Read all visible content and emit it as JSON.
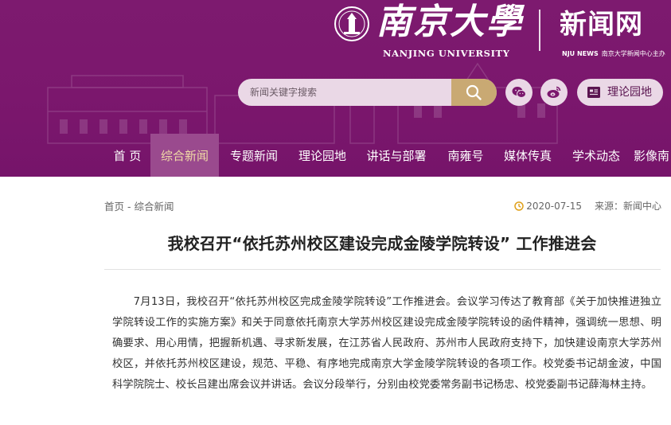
{
  "header": {
    "logo_cn": "南京大學",
    "logo_en": "NANJING UNIVERSITY",
    "site_name": "新闻网",
    "site_sub_brand": "NJU NEWS",
    "site_sub_text": "南京大学新闻中心主办",
    "search_placeholder": "新闻关键字搜索",
    "theory_label": "理论园地",
    "colors": {
      "header_bg": "#7b176d",
      "search_button": "#c9a973",
      "active_nav_bg": "#9a4a8e",
      "active_nav_text": "#f1dca6"
    }
  },
  "nav": {
    "items": [
      {
        "label": "首 页"
      },
      {
        "label": "综合新闻"
      },
      {
        "label": "专题新闻"
      },
      {
        "label": "理论园地"
      },
      {
        "label": "讲话与部署"
      },
      {
        "label": "南雍号"
      },
      {
        "label": "媒体传真"
      },
      {
        "label": "学术动态"
      },
      {
        "label": "影像南"
      }
    ]
  },
  "breadcrumb": {
    "home": "首页",
    "separator": "-",
    "current": "综合新闻"
  },
  "meta": {
    "date": "2020-07-15",
    "source": "来源：新闻中心"
  },
  "article": {
    "title": "我校召开“依托苏州校区建设完成金陵学院转设” 工作推进会",
    "body": "7月13日，我校召开“依托苏州校区完成金陵学院转设”工作推进会。会议学习传达了教育部《关于加快推进独立学院转设工作的实施方案》和关于同意依托南京大学苏州校区建设完成金陵学院转设的函件精神，强调统一思想、明确要求、用心用情，把握新机遇、寻求新发展，在江苏省人民政府、苏州市人民政府支持下，加快建设南京大学苏州校区，并依托苏州校区建设，规范、平稳、有序地完成南京大学金陵学院转设的各项工作。校党委书记胡金波，中国科学院院士、校长吕建出席会议并讲话。会议分段举行，分别由校党委常务副书记杨忠、校党委副书记薛海林主持。"
  },
  "icons": {
    "search": "search-icon",
    "wechat": "wechat-icon",
    "weibo": "weibo-icon",
    "book": "book-icon",
    "clock": "clock-icon",
    "emblem": "university-emblem-icon"
  }
}
